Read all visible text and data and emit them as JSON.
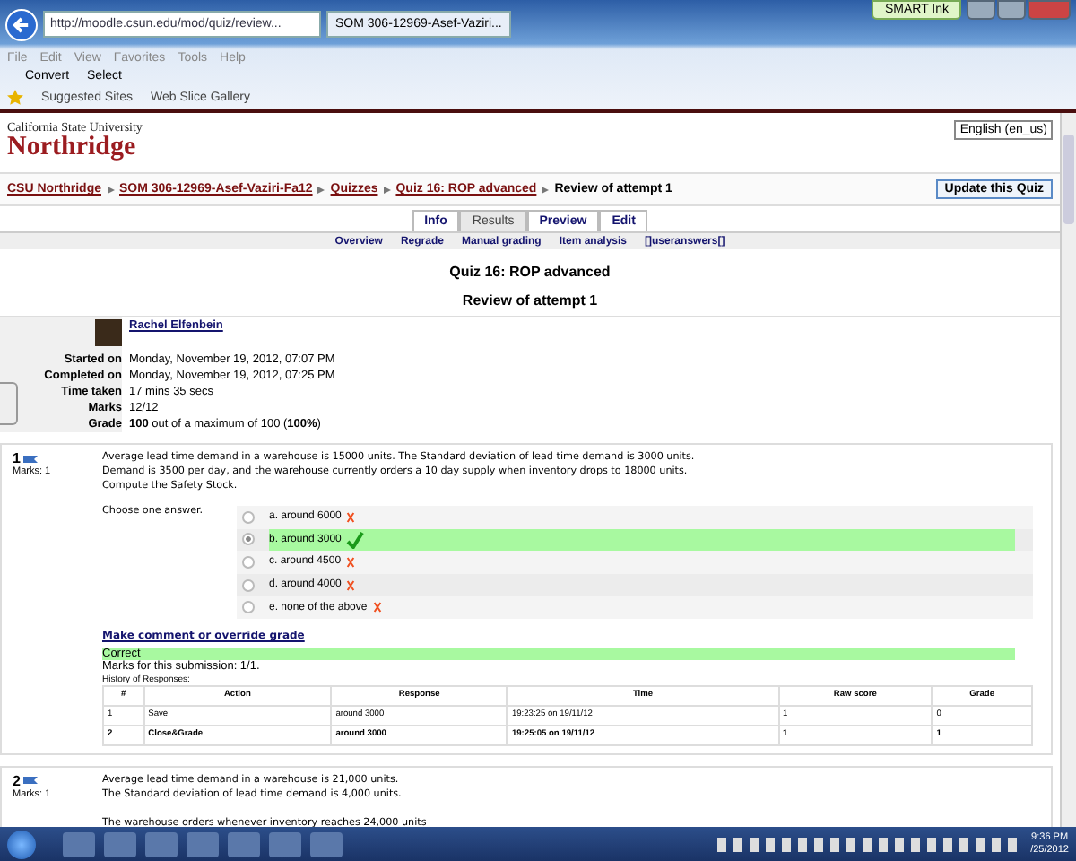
{
  "browser": {
    "address": "http://moodle.csun.edu/mod/quiz/review...",
    "tab": "SOM 306-12969-Asef-Vaziri...",
    "smart_ink": "SMART Ink",
    "menu": [
      "File",
      "Edit",
      "View",
      "Favorites",
      "Tools",
      "Help"
    ],
    "toolbar": [
      "Convert",
      "Select"
    ],
    "favorites": [
      "Suggested Sites",
      "Web Slice Gallery"
    ]
  },
  "header": {
    "logo_top": "California State University",
    "logo_bottom": "Northridge",
    "language": "English (en_us)"
  },
  "breadcrumb": [
    "CSU Northridge",
    "SOM 306-12969-Asef-Vaziri-Fa12",
    "Quizzes",
    "Quiz 16: ROP advanced",
    "Review of attempt 1"
  ],
  "update_button": "Update this Quiz",
  "tabs": [
    {
      "label": "Info",
      "selected": false
    },
    {
      "label": "Results",
      "selected": true
    },
    {
      "label": "Preview",
      "selected": false
    },
    {
      "label": "Edit",
      "selected": false
    }
  ],
  "subtabs": [
    "Overview",
    "Regrade",
    "Manual grading",
    "Item analysis",
    "[]useranswers[]"
  ],
  "title": "Quiz 16: ROP advanced",
  "subtitle": "Review of attempt 1",
  "summary": {
    "user": "Rachel Elfenbein",
    "rows": [
      {
        "label": "Started on",
        "value": "Monday, November 19, 2012, 07:07 PM"
      },
      {
        "label": "Completed on",
        "value": "Monday, November 19, 2012, 07:25 PM"
      },
      {
        "label": "Time taken",
        "value": "17 mins 35 secs"
      },
      {
        "label": "Marks",
        "value": "12/12"
      },
      {
        "label": "Grade",
        "value": "**100** out of a maximum of 100 (**100%**)"
      }
    ]
  },
  "questions": [
    {
      "number": "1",
      "marks": "Marks: 1",
      "text": [
        [
          "Average lead time demand in a warehouse is 15000 units. The Standard deviation of lead time demand is 3000 units.",
          "Demand is 3500 per day, and the warehouse currently orders a 10 day supply when inventory drops to 18000 units.",
          "Compute the Safety Stock."
        ]
      ],
      "prompt": "Choose one answer.",
      "options": [
        {
          "label": "a. around 6000",
          "selected": false,
          "correct": false
        },
        {
          "label": "b. around 3000",
          "selected": true,
          "correct": true
        },
        {
          "label": "c. around 4500",
          "selected": false,
          "correct": false
        },
        {
          "label": "d. around 4000",
          "selected": false,
          "correct": false
        },
        {
          "label": "e. none of the above",
          "selected": false,
          "correct": false
        }
      ],
      "comment_link": "Make comment or override grade",
      "feedback": "Correct",
      "marks_line": "Marks for this submission: 1/1.",
      "history": {
        "caption": "History of Responses:",
        "columns": [
          "#",
          "Action",
          "Response",
          "Time",
          "Raw score",
          "Grade"
        ],
        "rows": [
          {
            "cells": [
              "1",
              "Save",
              "around 3000",
              "19:23:25 on 19/11/12",
              "1",
              "0"
            ],
            "bold": false
          },
          {
            "cells": [
              "2",
              "Close&Grade",
              "around 3000",
              "19:25:05 on 19/11/12",
              "1",
              "1"
            ],
            "bold": true
          }
        ]
      }
    },
    {
      "number": "2",
      "marks": "Marks: 1",
      "text": [
        [
          "Average lead time demand in a warehouse is 21,000 units.",
          "The Standard deviation of lead time demand is 4,000 units."
        ],
        [
          "The warehouse orders whenever inventory reaches 24,000 units"
        ]
      ]
    }
  ],
  "taskbar": {
    "time": "9:36 PM",
    "date": "/25/2012"
  }
}
